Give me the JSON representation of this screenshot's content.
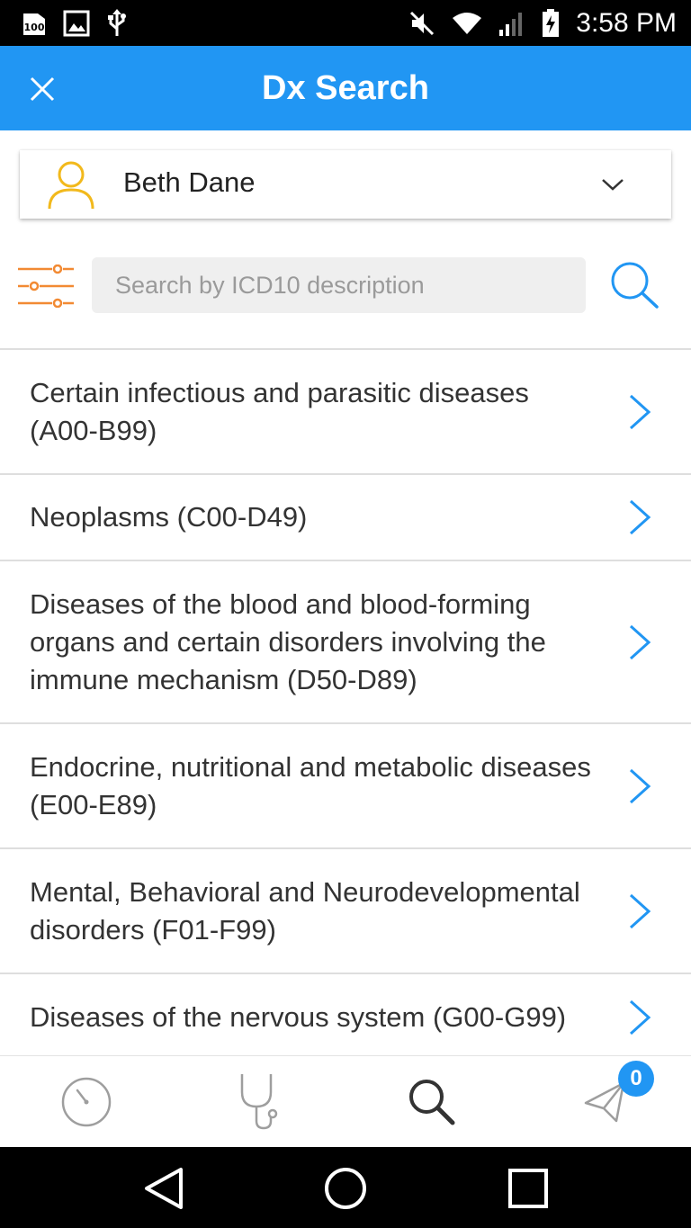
{
  "status_bar": {
    "time": "3:58 PM",
    "left_icons": [
      "storage-100-icon",
      "image-icon",
      "usb-icon"
    ],
    "right_icons": [
      "mute-icon",
      "wifi-icon",
      "signal-icon",
      "battery-charging-icon"
    ]
  },
  "app_bar": {
    "title": "Dx Search",
    "close_icon": "close-icon"
  },
  "patient": {
    "name": "Beth Dane",
    "avatar_icon": "user-icon",
    "dropdown_icon": "chevron-down-icon"
  },
  "search": {
    "placeholder": "Search by ICD10 description",
    "value": "",
    "filter_icon": "sliders-icon",
    "search_icon": "search-icon"
  },
  "categories": [
    {
      "label": "Certain infectious and parasitic diseases (A00-B99)"
    },
    {
      "label": "Neoplasms (C00-D49)"
    },
    {
      "label": "Diseases of the blood and blood-forming organs and certain disorders involving the immune mechanism (D50-D89)"
    },
    {
      "label": "Endocrine, nutritional and metabolic diseases (E00-E89)"
    },
    {
      "label": "Mental, Behavioral and Neurodevelopmental disorders (F01-F99)"
    },
    {
      "label": "Diseases of the nervous system (G00-G99)"
    }
  ],
  "bottom_nav": {
    "items": [
      "history-icon",
      "stethoscope-icon",
      "search-icon",
      "send-icon"
    ],
    "active_index": 2,
    "send_badge": "0"
  },
  "system_nav": [
    "back-icon",
    "home-icon",
    "recents-icon"
  ],
  "colors": {
    "accent": "#2196f3",
    "avatar": "#f2b91c",
    "filter": "#f28a33",
    "divider": "#dedede"
  }
}
